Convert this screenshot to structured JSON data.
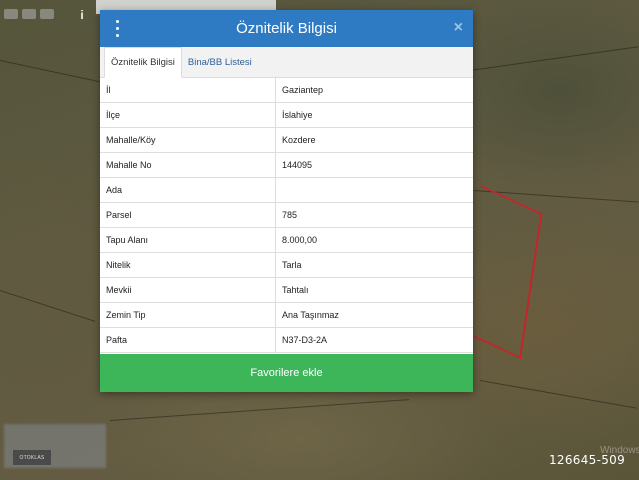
{
  "dialog": {
    "title": "Öznitelik Bilgisi",
    "menu_icon": "kebab-menu-icon",
    "close_label": "×",
    "tabs": [
      {
        "label": "Öznitelik Bilgisi",
        "active": true
      },
      {
        "label": "Bina/BB Listesi",
        "active": false
      }
    ],
    "rows": [
      {
        "key": "İl",
        "value": "Gaziantep"
      },
      {
        "key": "İlçe",
        "value": "İslahiye"
      },
      {
        "key": "Mahalle/Köy",
        "value": "Kozdere"
      },
      {
        "key": "Mahalle No",
        "value": "144095"
      },
      {
        "key": "Ada",
        "value": ""
      },
      {
        "key": "Parsel",
        "value": "785"
      },
      {
        "key": "Tapu Alanı",
        "value": "8.000,00"
      },
      {
        "key": "Nitelik",
        "value": "Tarla"
      },
      {
        "key": "Mevkii",
        "value": "Tahtalı"
      },
      {
        "key": "Zemin Tip",
        "value": "Ana Taşınmaz"
      },
      {
        "key": "Pafta",
        "value": "N37-D3-2A"
      }
    ],
    "favorite_button": "Favorilere ekle"
  },
  "overlay": {
    "info_icon": "i",
    "listing_id": "126645-509",
    "logo_text": "OTOKLAS",
    "windows_watermark": "Windows"
  },
  "colors": {
    "header": "#2f7bc3",
    "favorite": "#3db559",
    "parcel_border": "#c0272d"
  }
}
